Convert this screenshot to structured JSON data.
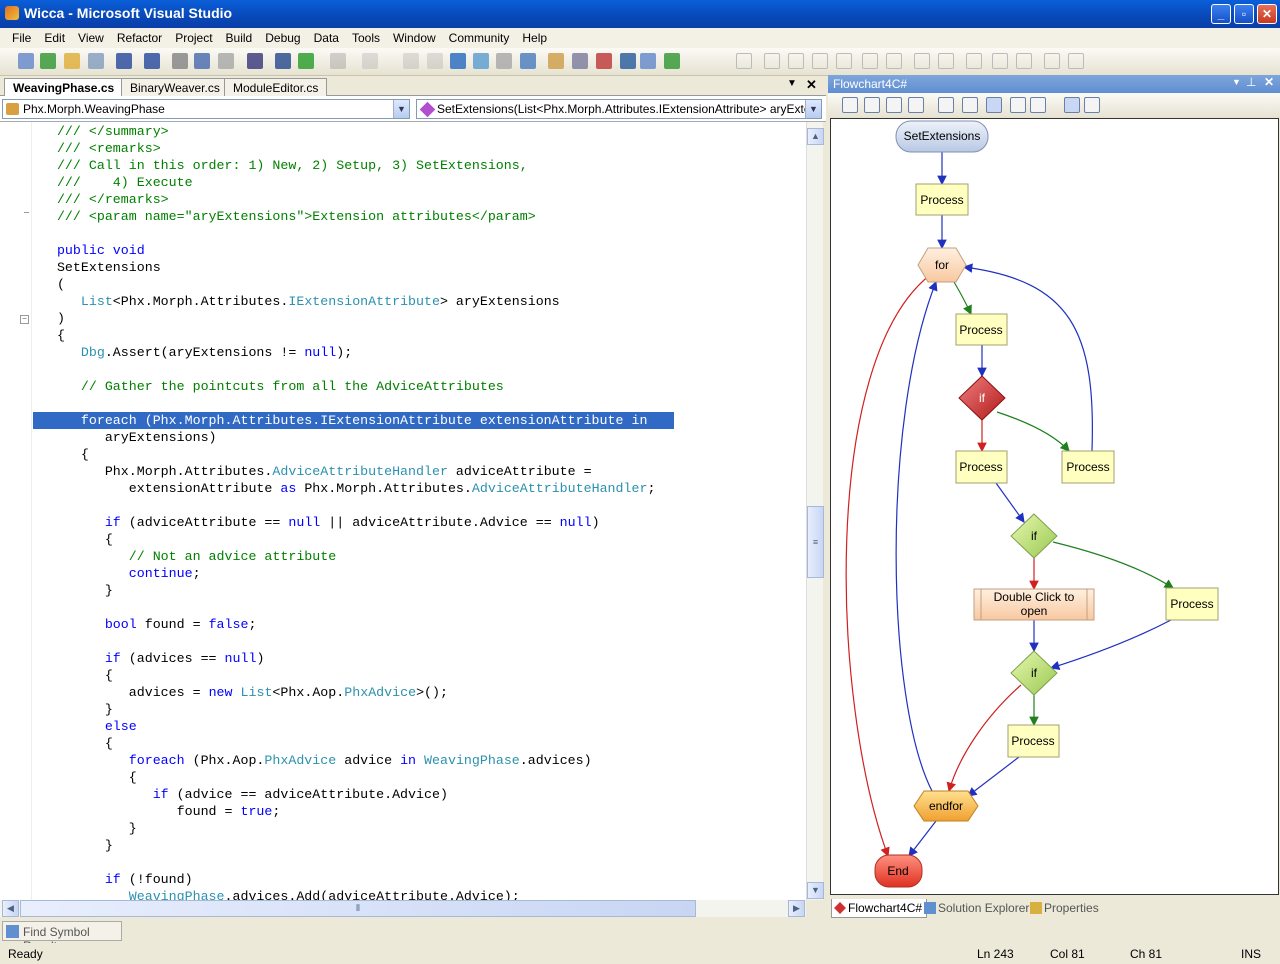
{
  "window": {
    "title": "Wicca - Microsoft Visual Studio"
  },
  "menu": [
    "File",
    "Edit",
    "View",
    "Refactor",
    "Project",
    "Build",
    "Debug",
    "Data",
    "Tools",
    "Window",
    "Community",
    "Help"
  ],
  "editor": {
    "tabs": [
      {
        "label": "WeavingPhase.cs",
        "active": true
      },
      {
        "label": "BinaryWeaver.cs"
      },
      {
        "label": "ModuleEditor.cs"
      }
    ],
    "type_combo": "Phx.Morph.WeavingPhase",
    "member_combo": "SetExtensions(List<Phx.Morph.Attributes.IExtensionAttribute> aryExtensions)",
    "selected_line": 17,
    "lines": [
      [
        [
          "c",
          "   /// </summary>"
        ]
      ],
      [
        [
          "c",
          "   /// <remarks>"
        ]
      ],
      [
        [
          "c",
          "   /// Call in this order: 1) New, 2) Setup, 3) SetExtensions,"
        ]
      ],
      [
        [
          "c",
          "   ///    4) Execute"
        ]
      ],
      [
        [
          "c",
          "   /// </remarks>"
        ]
      ],
      [
        [
          "c",
          "   /// <param name=\"aryExtensions\">Extension attributes</param>"
        ]
      ],
      [],
      [
        [
          "k",
          "   public void"
        ]
      ],
      [
        [
          "n",
          "   SetExtensions"
        ]
      ],
      [
        [
          "n",
          "   ("
        ]
      ],
      [
        [
          "t",
          "      List"
        ],
        [
          "n",
          "<Phx.Morph.Attributes."
        ],
        [
          "t",
          "IExtensionAttribute"
        ],
        [
          "n",
          "> aryExtensions"
        ]
      ],
      [
        [
          "n",
          "   )"
        ]
      ],
      [
        [
          "n",
          "   {"
        ]
      ],
      [
        [
          "t",
          "      Dbg"
        ],
        [
          "n",
          ".Assert(aryExtensions != "
        ],
        [
          "k",
          "null"
        ],
        [
          "n",
          ");"
        ]
      ],
      [],
      [
        [
          "c",
          "      // Gather the pointcuts from all the AdviceAttributes"
        ]
      ],
      [],
      [
        [
          "k",
          "      foreach"
        ],
        [
          "n",
          " (Phx.Morph.Attributes.IExtensionAttribute extensionAttribute "
        ],
        [
          "k",
          "in"
        ]
      ],
      [
        [
          "n",
          "         aryExtensions)"
        ]
      ],
      [
        [
          "n",
          "      {"
        ]
      ],
      [
        [
          "n",
          "         Phx.Morph.Attributes."
        ],
        [
          "t",
          "AdviceAttributeHandler"
        ],
        [
          "n",
          " adviceAttribute ="
        ]
      ],
      [
        [
          "n",
          "            extensionAttribute "
        ],
        [
          "k",
          "as"
        ],
        [
          "n",
          " Phx.Morph.Attributes."
        ],
        [
          "t",
          "AdviceAttributeHandler"
        ],
        [
          "n",
          ";"
        ]
      ],
      [],
      [
        [
          "k",
          "         if"
        ],
        [
          "n",
          " (adviceAttribute == "
        ],
        [
          "k",
          "null"
        ],
        [
          "n",
          " || adviceAttribute.Advice == "
        ],
        [
          "k",
          "null"
        ],
        [
          "n",
          ")"
        ]
      ],
      [
        [
          "n",
          "         {"
        ]
      ],
      [
        [
          "c",
          "            // Not an advice attribute"
        ]
      ],
      [
        [
          "k",
          "            continue"
        ],
        [
          "n",
          ";"
        ]
      ],
      [
        [
          "n",
          "         }"
        ]
      ],
      [],
      [
        [
          "k",
          "         bool"
        ],
        [
          "n",
          " found = "
        ],
        [
          "k",
          "false"
        ],
        [
          "n",
          ";"
        ]
      ],
      [],
      [
        [
          "k",
          "         if"
        ],
        [
          "n",
          " (advices == "
        ],
        [
          "k",
          "null"
        ],
        [
          "n",
          ")"
        ]
      ],
      [
        [
          "n",
          "         {"
        ]
      ],
      [
        [
          "n",
          "            advices = "
        ],
        [
          "k",
          "new"
        ],
        [
          "n",
          " "
        ],
        [
          "t",
          "List"
        ],
        [
          "n",
          "<Phx.Aop."
        ],
        [
          "t",
          "PhxAdvice"
        ],
        [
          "n",
          ">();"
        ]
      ],
      [
        [
          "n",
          "         }"
        ]
      ],
      [
        [
          "k",
          "         else"
        ]
      ],
      [
        [
          "n",
          "         {"
        ]
      ],
      [
        [
          "k",
          "            foreach"
        ],
        [
          "n",
          " (Phx.Aop."
        ],
        [
          "t",
          "PhxAdvice"
        ],
        [
          "n",
          " advice "
        ],
        [
          "k",
          "in"
        ],
        [
          "n",
          " "
        ],
        [
          "t",
          "WeavingPhase"
        ],
        [
          "n",
          ".advices)"
        ]
      ],
      [
        [
          "n",
          "            {"
        ]
      ],
      [
        [
          "k",
          "               if"
        ],
        [
          "n",
          " (advice == adviceAttribute.Advice)"
        ]
      ],
      [
        [
          "n",
          "                  found = "
        ],
        [
          "k",
          "true"
        ],
        [
          "n",
          ";"
        ]
      ],
      [
        [
          "n",
          "            }"
        ]
      ],
      [
        [
          "n",
          "         }"
        ]
      ],
      [],
      [
        [
          "k",
          "         if"
        ],
        [
          "n",
          " (!found)"
        ]
      ],
      [
        [
          "t",
          "            WeavingPhase"
        ],
        [
          "n",
          ".advices.Add(adviceAttribute.Advice);"
        ]
      ]
    ]
  },
  "flowchart": {
    "title": "Flowchart4C#",
    "nodes": {
      "start": "SetExtensions",
      "p1": "Process",
      "for": "for",
      "p2": "Process",
      "if1": "if",
      "p3": "Process",
      "p4": "Process",
      "if2": "if",
      "dbl1": "Double Click to",
      "dbl2": "open",
      "p5": "Process",
      "if3": "if",
      "p6": "Process",
      "endfor": "endfor",
      "end": "End"
    },
    "colors": {
      "edge_blue": "#2030c0",
      "edge_green": "#208020",
      "edge_red": "#d02020",
      "process": "#ffffc0"
    }
  },
  "bottom_tabs": [
    "Flowchart4C#",
    "Solution Explorer",
    "Properties"
  ],
  "find_symbol": "Find Symbol Results",
  "status": {
    "text": "Ready",
    "ln": "Ln 243",
    "col": "Col 81",
    "ch": "Ch 81",
    "mode": "INS"
  }
}
